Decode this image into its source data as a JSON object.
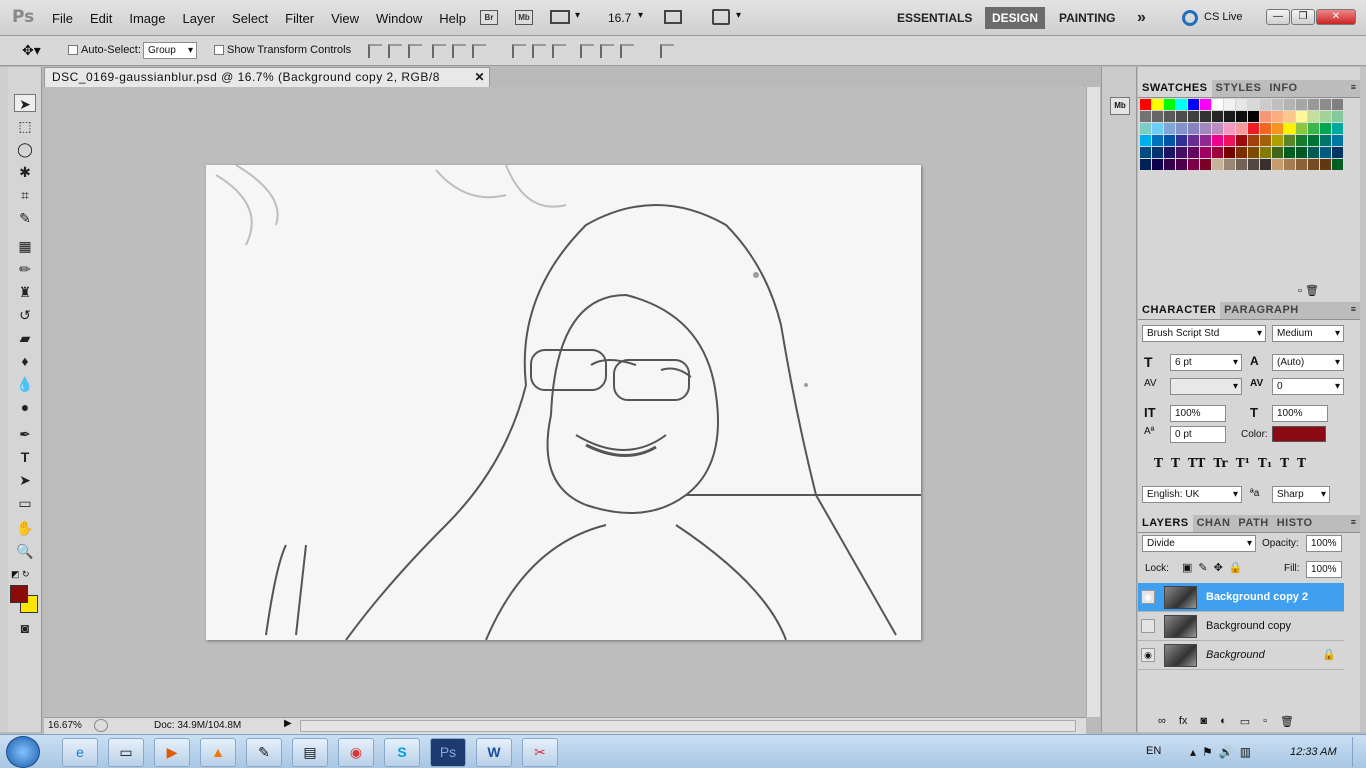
{
  "app": {
    "logo": "Ps"
  },
  "menu": [
    "File",
    "Edit",
    "Image",
    "Layer",
    "Select",
    "Filter",
    "View",
    "Window",
    "Help"
  ],
  "appbar": {
    "bridge": "Br",
    "minibridge": "Mb",
    "zoom": "16.7"
  },
  "workspaces": {
    "essentials": "ESSENTIALS",
    "design": "DESIGN",
    "painting": "PAINTING",
    "more": "»",
    "cslive": "CS Live"
  },
  "options": {
    "auto_select_label": "Auto-Select:",
    "auto_select_value": "Group",
    "transform_label": "Show Transform Controls"
  },
  "document": {
    "tab_title": "DSC_0169-gaussianblur.psd @ 16.7% (Background copy 2, RGB/8",
    "zoom": "16.67%",
    "doc_info": "Doc: 34.9M/104.8M"
  },
  "colors": {
    "foreground": "#8b0a0a",
    "background": "#ffe600",
    "text_color": "#8b0a14",
    "selected_layer": "#3f9ff0"
  },
  "swatches": {
    "tabs": [
      "SWATCHES",
      "STYLES",
      "INFO"
    ],
    "colors": [
      "#ff0000",
      "#ffff00",
      "#00ff00",
      "#00ffff",
      "#0000ff",
      "#ff00ff",
      "#ffffff",
      "#f2f2f2",
      "#e6e6e6",
      "#d9d9d9",
      "#cccccc",
      "#bfbfbf",
      "#b3b3b3",
      "#a6a6a6",
      "#999999",
      "#8c8c8c",
      "#808080",
      "#737373",
      "#666666",
      "#595959",
      "#4d4d4d",
      "#404040",
      "#333333",
      "#262626",
      "#1a1a1a",
      "#0d0d0d",
      "#000000",
      "#f7977a",
      "#f9ad81",
      "#fdc68a",
      "#fff79a",
      "#c4df9b",
      "#a3d39c",
      "#82ca9d",
      "#7bcdc8",
      "#6ecff6",
      "#7ea7d8",
      "#8493ca",
      "#8882be",
      "#a187be",
      "#bc8dbf",
      "#f49ac2",
      "#f6989d",
      "#ed1c24",
      "#f26522",
      "#f7941d",
      "#fff200",
      "#8dc73f",
      "#39b54a",
      "#00a651",
      "#00a99d",
      "#00aeef",
      "#0072bc",
      "#0054a6",
      "#2e3192",
      "#662d91",
      "#92278f",
      "#ec008c",
      "#ed145b",
      "#9e0b0f",
      "#a0410d",
      "#a3620a",
      "#aba000",
      "#598527",
      "#197b30",
      "#007236",
      "#00746b",
      "#0076a3",
      "#004b80",
      "#003471",
      "#1b1464",
      "#440e62",
      "#630460",
      "#9e005d",
      "#9e0039",
      "#790000",
      "#7b2e00",
      "#7d4900",
      "#827b00",
      "#406618",
      "#005e20",
      "#005826",
      "#005952",
      "#005b7f",
      "#003663",
      "#002157",
      "#0d004c",
      "#32004b",
      "#4b0049",
      "#7b0046",
      "#7a0026",
      "#c7b299",
      "#998675",
      "#736357",
      "#534741",
      "#37302d",
      "#c69c6d",
      "#a67c52",
      "#8c6239",
      "#754c24",
      "#603913",
      "#005e20"
    ]
  },
  "character": {
    "tabs": [
      "CHARACTER",
      "PARAGRAPH"
    ],
    "font_family": "Brush Script Std",
    "font_style": "Medium",
    "font_size": "6 pt",
    "leading": "(Auto)",
    "kerning": "",
    "tracking": "0",
    "vertical_scale": "100%",
    "horizontal_scale": "100%",
    "baseline_shift": "0 pt",
    "color_label": "Color:",
    "language": "English: UK",
    "antialias": "Sharp",
    "style_buttons": [
      "T",
      "T",
      "TT",
      "Tr",
      "T¹",
      "T₁",
      "T",
      "T"
    ]
  },
  "layers": {
    "tabs": [
      "LAYERS",
      "CHAN",
      "PATH",
      "HISTO"
    ],
    "blend_mode": "Divide",
    "opacity_label": "Opacity:",
    "opacity": "100%",
    "lock_label": "Lock:",
    "fill_label": "Fill:",
    "fill": "100%",
    "items": [
      {
        "name": "Background copy 2",
        "visible": true,
        "selected": true
      },
      {
        "name": "Background copy",
        "visible": false,
        "selected": false
      },
      {
        "name": "Background",
        "visible": true,
        "selected": false,
        "locked": true
      }
    ],
    "footer_icons": [
      "link-icon",
      "fx-icon",
      "mask-icon",
      "adjustment-icon",
      "group-icon",
      "new-layer-icon",
      "trash-icon"
    ]
  },
  "taskbar": {
    "lang": "EN",
    "clock": "12:33 AM"
  }
}
